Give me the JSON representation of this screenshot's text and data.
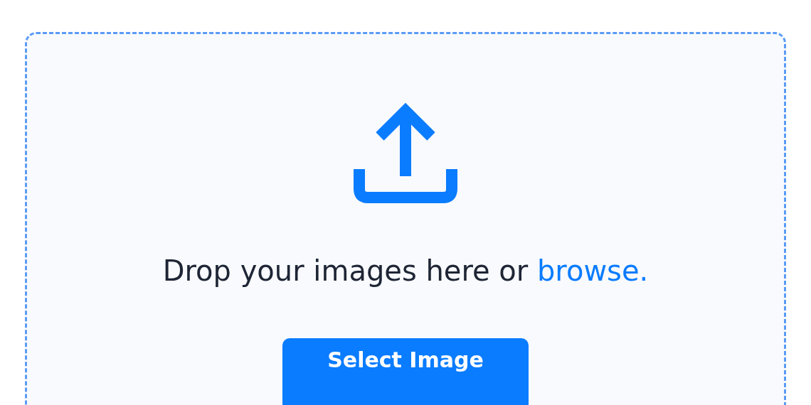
{
  "dropzone": {
    "prompt": "Drop your images here or",
    "link": "browse.",
    "button": "Select Image"
  }
}
